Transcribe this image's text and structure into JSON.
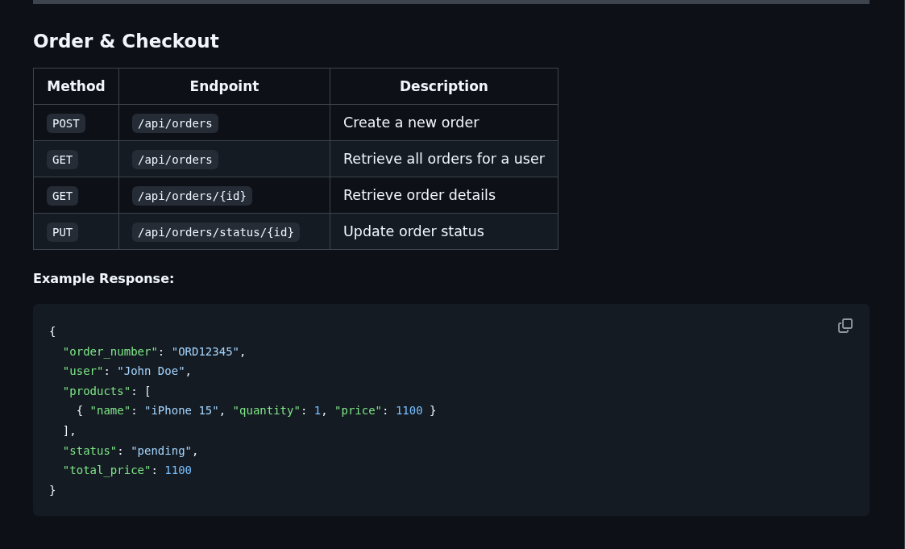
{
  "heading": "Order & Checkout",
  "table": {
    "columns": [
      "Method",
      "Endpoint",
      "Description"
    ],
    "rows": [
      {
        "method": "POST",
        "endpoint": "/api/orders",
        "description": "Create a new order"
      },
      {
        "method": "GET",
        "endpoint": "/api/orders",
        "description": "Retrieve all orders for a user"
      },
      {
        "method": "GET",
        "endpoint": "/api/orders/{id}",
        "description": "Retrieve order details"
      },
      {
        "method": "PUT",
        "endpoint": "/api/orders/status/{id}",
        "description": "Update order status"
      }
    ]
  },
  "example_label": "Example Response:",
  "code_block": {
    "lines": [
      [
        {
          "kind": "punct",
          "text": "{"
        }
      ],
      [
        {
          "kind": "key",
          "text": "  \"order_number\""
        },
        {
          "kind": "punct",
          "text": ": "
        },
        {
          "kind": "string",
          "text": "\"ORD12345\""
        },
        {
          "kind": "punct",
          "text": ","
        }
      ],
      [
        {
          "kind": "key",
          "text": "  \"user\""
        },
        {
          "kind": "punct",
          "text": ": "
        },
        {
          "kind": "string",
          "text": "\"John Doe\""
        },
        {
          "kind": "punct",
          "text": ","
        }
      ],
      [
        {
          "kind": "key",
          "text": "  \"products\""
        },
        {
          "kind": "punct",
          "text": ": ["
        }
      ],
      [
        {
          "kind": "punct",
          "text": "    { "
        },
        {
          "kind": "key",
          "text": "\"name\""
        },
        {
          "kind": "punct",
          "text": ": "
        },
        {
          "kind": "string",
          "text": "\"iPhone 15\""
        },
        {
          "kind": "punct",
          "text": ", "
        },
        {
          "kind": "key",
          "text": "\"quantity\""
        },
        {
          "kind": "punct",
          "text": ": "
        },
        {
          "kind": "number",
          "text": "1"
        },
        {
          "kind": "punct",
          "text": ", "
        },
        {
          "kind": "key",
          "text": "\"price\""
        },
        {
          "kind": "punct",
          "text": ": "
        },
        {
          "kind": "number",
          "text": "1100"
        },
        {
          "kind": "punct",
          "text": " }"
        }
      ],
      [
        {
          "kind": "punct",
          "text": "  ],"
        }
      ],
      [
        {
          "kind": "key",
          "text": "  \"status\""
        },
        {
          "kind": "punct",
          "text": ": "
        },
        {
          "kind": "string",
          "text": "\"pending\""
        },
        {
          "kind": "punct",
          "text": ","
        }
      ],
      [
        {
          "kind": "key",
          "text": "  \"total_price\""
        },
        {
          "kind": "punct",
          "text": ": "
        },
        {
          "kind": "number",
          "text": "1100"
        }
      ],
      [
        {
          "kind": "punct",
          "text": "}"
        }
      ]
    ]
  }
}
